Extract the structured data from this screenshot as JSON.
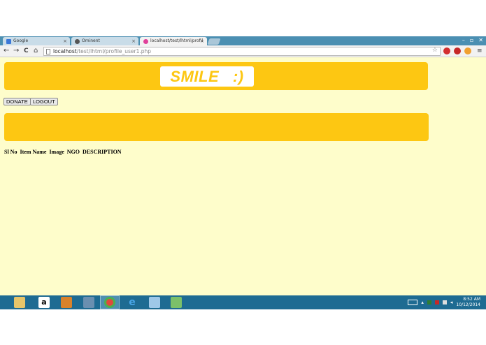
{
  "browser": {
    "tabs": [
      {
        "title": "Google",
        "close": "×"
      },
      {
        "title": "Ominent",
        "close": "×"
      },
      {
        "title": "localhost/test/lhtml/profil",
        "close": "×"
      }
    ],
    "window_controls": {
      "minimize": "–",
      "maximize": "▫",
      "close": "✕"
    },
    "nav": {
      "back": "←",
      "forward": "→",
      "reload": "C",
      "home": "⌂"
    },
    "address": {
      "host": "localhost",
      "path": "/test/lhtml/profile_user1.php"
    },
    "menu_icon": "≡"
  },
  "page": {
    "logo_text": "SMILE   :)",
    "buttons": {
      "donate": "DONATE",
      "logout": "LOGOUT"
    },
    "table_headers": [
      "Sl No",
      "Item Name",
      "Image",
      "NGO",
      "DESCRIPTION"
    ],
    "colors": {
      "background": "#fefdcb",
      "accent": "#fdc712"
    }
  },
  "taskbar": {
    "clock_time": "8:52 AM",
    "clock_date": "10/12/2014",
    "apps": [
      "file-explorer-icon",
      "amazon-icon",
      "app-icon",
      "paint-icon",
      "chrome-icon",
      "internet-explorer-icon",
      "notes-icon",
      "image-viewer-icon"
    ]
  }
}
